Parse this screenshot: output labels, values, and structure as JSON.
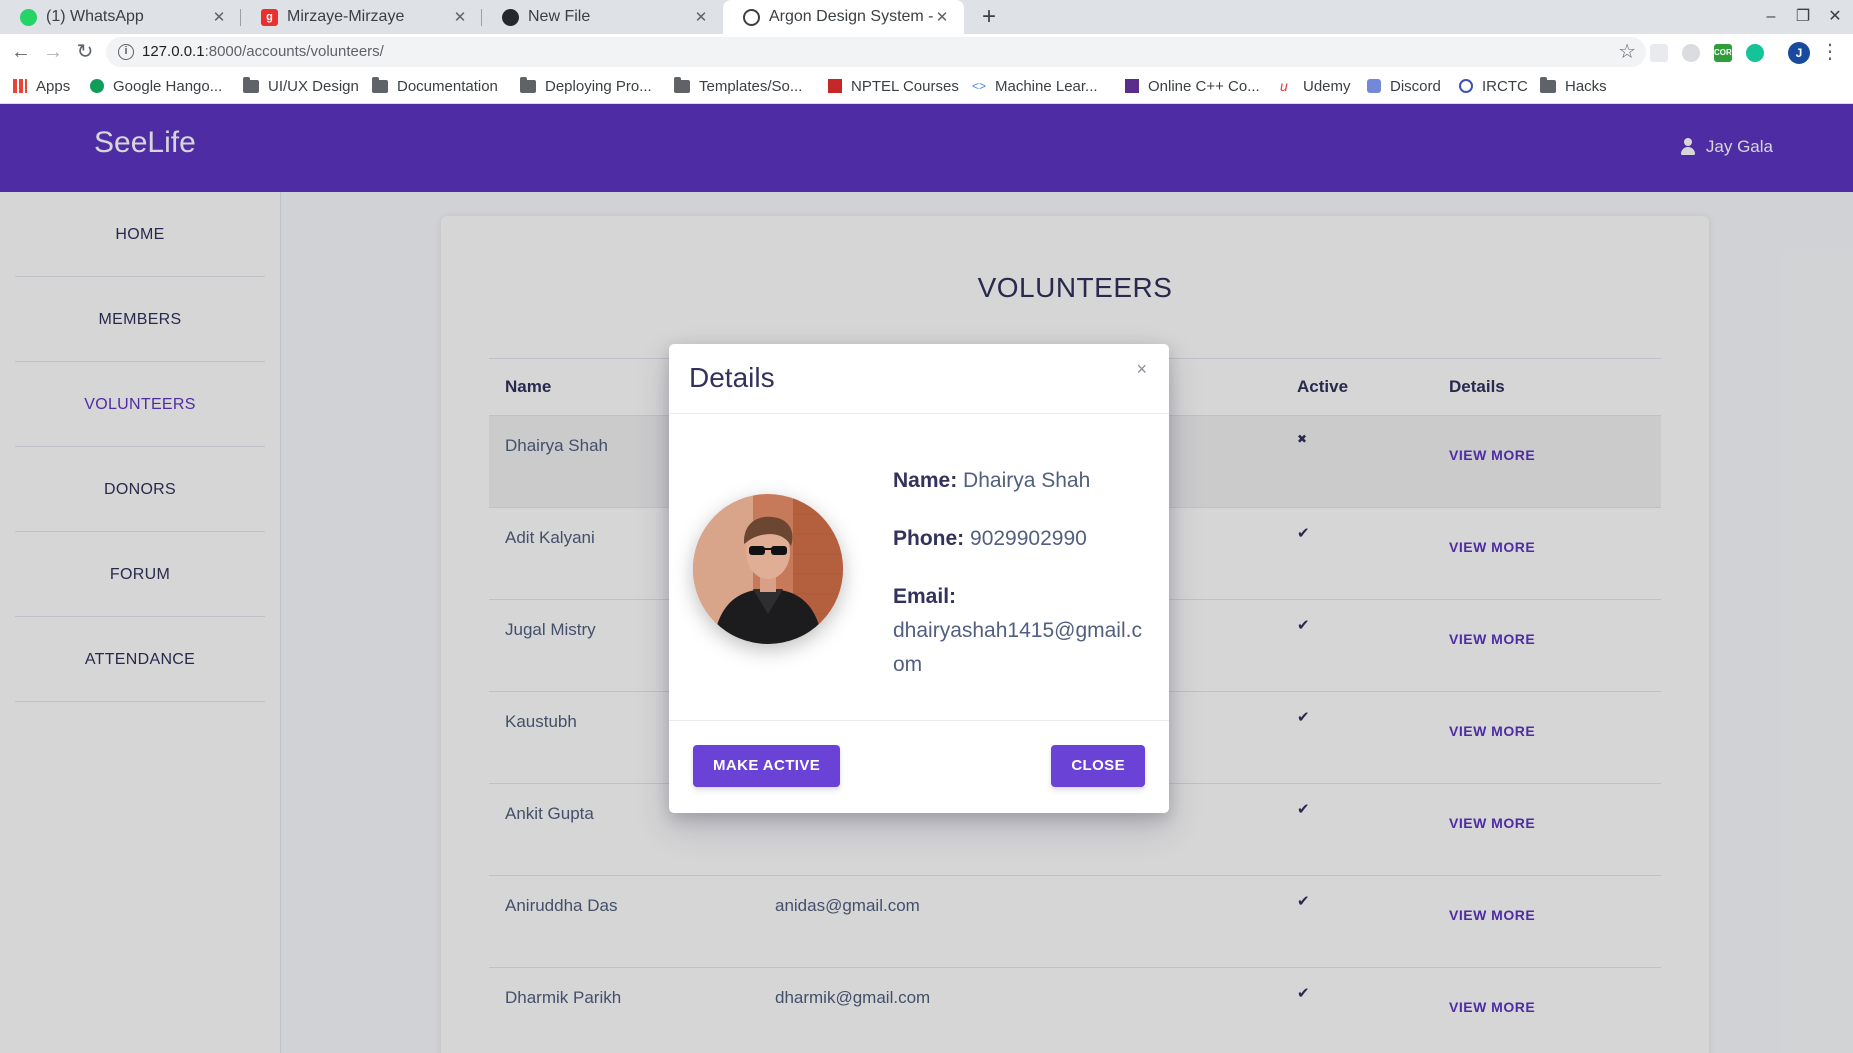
{
  "browser": {
    "tabs": [
      {
        "label": "(1) WhatsApp",
        "icon": "whatsapp-icon"
      },
      {
        "label": "Mirzaye-Mirzaye",
        "icon": "genius-icon"
      },
      {
        "label": "New File",
        "icon": "github-icon"
      },
      {
        "label": "Argon Design System - Fr",
        "icon": "argon-icon"
      }
    ],
    "new_tab": "+",
    "url_host": "127.0.0.1",
    "url_path": ":8000/accounts/volunteers/",
    "bookmarks": [
      {
        "label": "Apps",
        "icon": "apps-grid-icon"
      },
      {
        "label": "Google Hango...",
        "icon": "hangouts-icon"
      },
      {
        "label": "UI/UX Design",
        "icon": "folder-icon"
      },
      {
        "label": "Documentation",
        "icon": "folder-icon"
      },
      {
        "label": "Deploying Pro...",
        "icon": "folder-icon"
      },
      {
        "label": "Templates/So...",
        "icon": "folder-icon"
      },
      {
        "label": "NPTEL Courses",
        "icon": "nptel-icon"
      },
      {
        "label": "Machine Lear...",
        "icon": "code-icon"
      },
      {
        "label": "Online C++ Co...",
        "icon": "bolt-icon"
      },
      {
        "label": "Udemy",
        "icon": "udemy-icon"
      },
      {
        "label": "Discord",
        "icon": "discord-icon"
      },
      {
        "label": "IRCTC",
        "icon": "irctc-icon"
      },
      {
        "label": "Hacks",
        "icon": "folder-icon"
      }
    ],
    "profile_initial": "J",
    "ext_cors": "CORS"
  },
  "app": {
    "brand": "SeeLife",
    "user": "Jay Gala",
    "accent": "#5e35c4"
  },
  "sidebar": {
    "items": [
      {
        "label": "HOME"
      },
      {
        "label": "MEMBERS"
      },
      {
        "label": "VOLUNTEERS"
      },
      {
        "label": "DONORS"
      },
      {
        "label": "FORUM"
      },
      {
        "label": "ATTENDANCE"
      }
    ]
  },
  "main": {
    "title": "VOLUNTEERS",
    "columns": {
      "name": "Name",
      "active": "Active",
      "details": "Details"
    },
    "rows": [
      {
        "name": "Dhairya Shah",
        "email": "",
        "active": "✖",
        "view": "VIEW MORE"
      },
      {
        "name": "Adit Kalyani",
        "email": "",
        "active": "✔",
        "view": "VIEW MORE"
      },
      {
        "name": "Jugal Mistry",
        "email": "",
        "active": "✔",
        "view": "VIEW MORE"
      },
      {
        "name": "Kaustubh",
        "email": "",
        "active": "✔",
        "view": "VIEW MORE"
      },
      {
        "name": "Ankit Gupta",
        "email": "",
        "active": "✔",
        "view": "VIEW MORE"
      },
      {
        "name": "Aniruddha Das",
        "email": "anidas@gmail.com",
        "active": "✔",
        "view": "VIEW MORE"
      },
      {
        "name": "Dharmik Parikh",
        "email": "dharmik@gmail.com",
        "active": "✔",
        "view": "VIEW MORE"
      }
    ]
  },
  "modal": {
    "title": "Details",
    "close_icon": "×",
    "name_label": "Name:",
    "name": "Dhairya Shah",
    "phone_label": "Phone:",
    "phone": "9029902990",
    "email_label": "Email:",
    "email": "dhairyashah1415@gmail.com",
    "make_active": "MAKE ACTIVE",
    "close": "CLOSE"
  }
}
